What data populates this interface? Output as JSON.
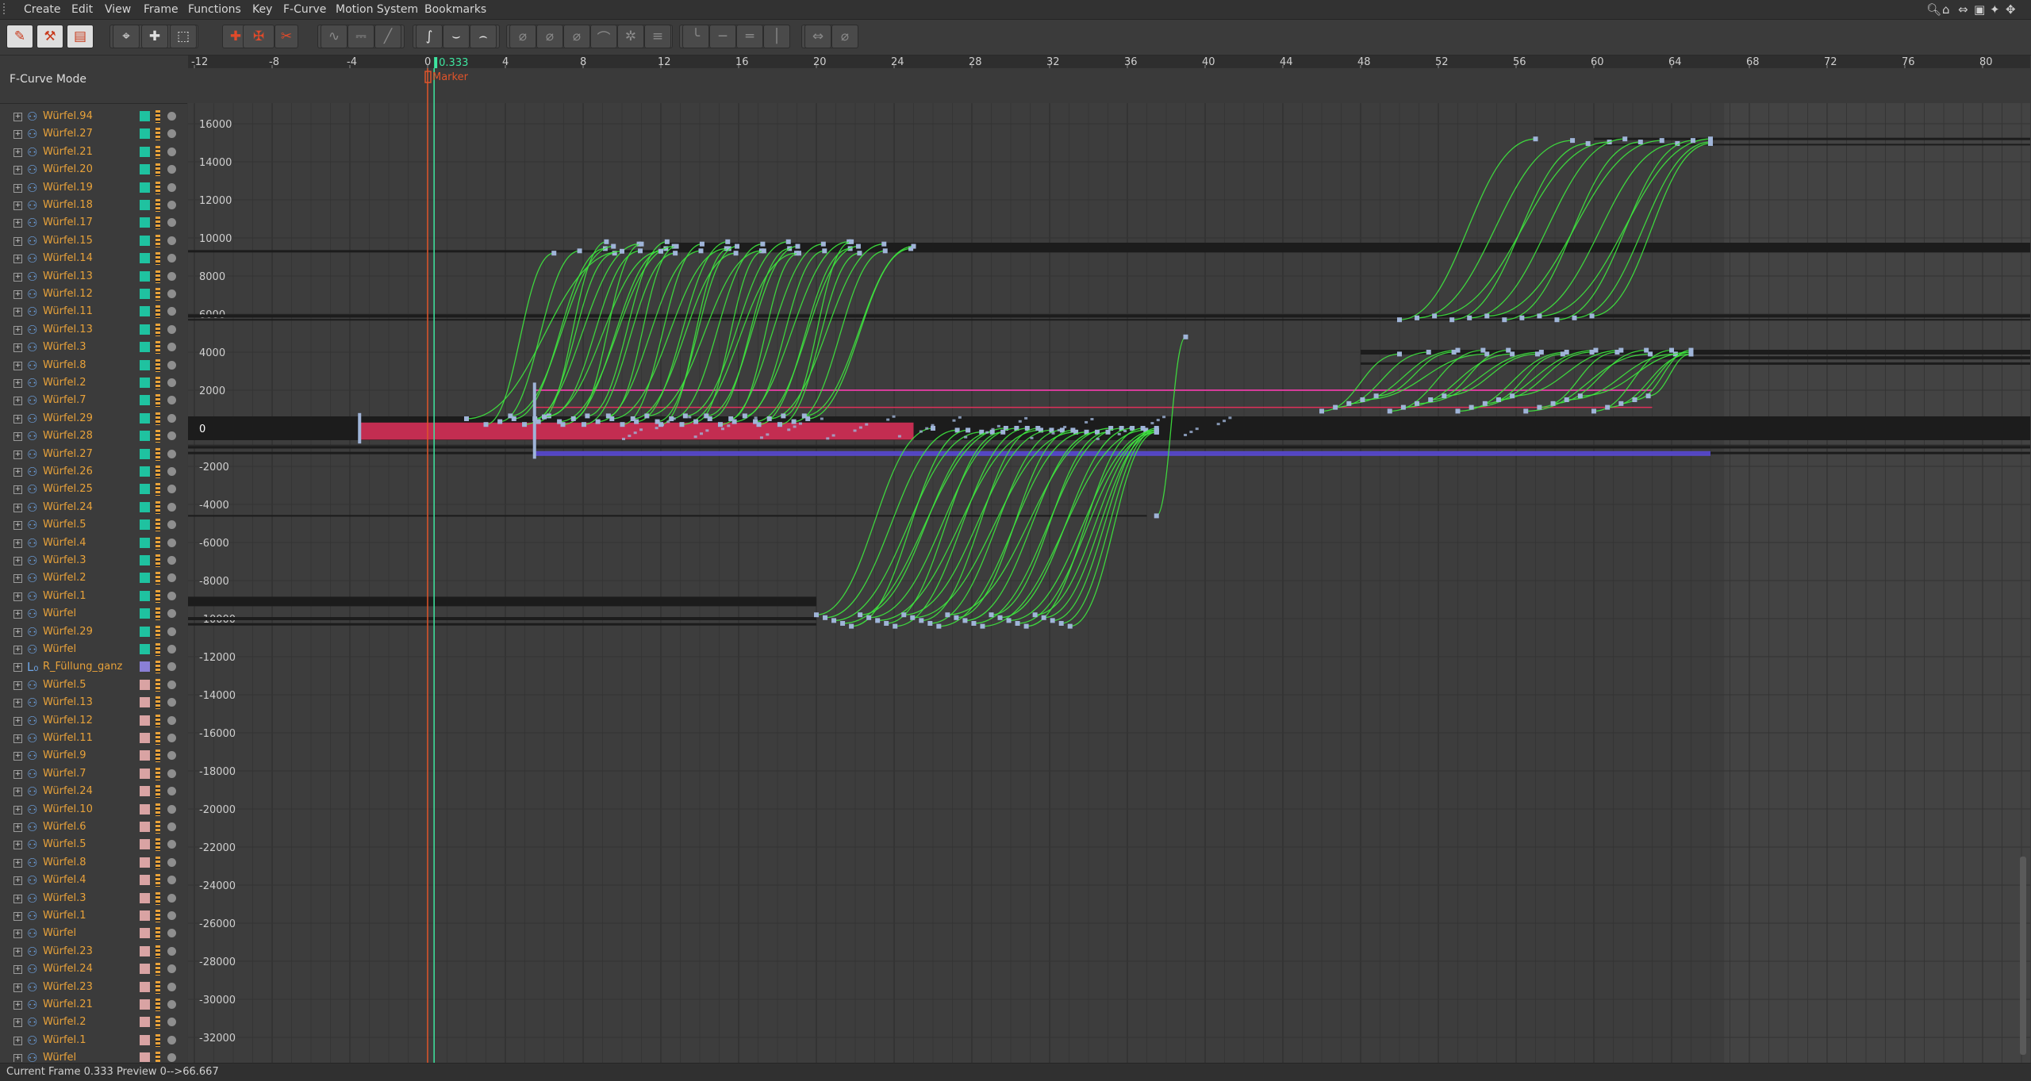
{
  "menu": [
    {
      "label": "Create",
      "key": "create"
    },
    {
      "label": "Edit",
      "key": "edit"
    },
    {
      "label": "View",
      "key": "view"
    },
    {
      "label": "Frame",
      "key": "frame"
    },
    {
      "label": "Functions",
      "key": "functions"
    },
    {
      "label": "Key",
      "key": "key"
    },
    {
      "label": "F-Curve",
      "key": "f-curve"
    },
    {
      "label": "Motion System",
      "key": "motion-system"
    },
    {
      "label": "Bookmarks",
      "key": "bookmarks"
    }
  ],
  "mode_label": "F-Curve Mode",
  "timeline": {
    "ticks": [
      "-12",
      "-8",
      "-4",
      "0",
      "4",
      "8",
      "12",
      "16",
      "20",
      "24",
      "28",
      "32",
      "36",
      "40",
      "44",
      "48",
      "52",
      "56",
      "60",
      "64",
      "68",
      "72",
      "76",
      "80"
    ],
    "current_frame": "0.333",
    "marker": "Marker"
  },
  "value_axis": [
    "16000",
    "14000",
    "12000",
    "10000",
    "8000",
    "6000",
    "4000",
    "2000",
    "0",
    "-2000",
    "-4000",
    "-6000",
    "-8000",
    "-10000",
    "-12000",
    "-14000",
    "-16000",
    "-18000",
    "-20000",
    "-22000",
    "-24000",
    "-26000",
    "-28000",
    "-30000",
    "-32000"
  ],
  "tree_items": [
    {
      "label": "Würfel.94",
      "color": "#1fc2a0"
    },
    {
      "label": "Würfel.27",
      "color": "#1fc2a0"
    },
    {
      "label": "Würfel.21",
      "color": "#1fc2a0"
    },
    {
      "label": "Würfel.20",
      "color": "#1fc2a0"
    },
    {
      "label": "Würfel.19",
      "color": "#1fc2a0"
    },
    {
      "label": "Würfel.18",
      "color": "#1fc2a0"
    },
    {
      "label": "Würfel.17",
      "color": "#1fc2a0"
    },
    {
      "label": "Würfel.15",
      "color": "#1fc2a0"
    },
    {
      "label": "Würfel.14",
      "color": "#1fc2a0"
    },
    {
      "label": "Würfel.13",
      "color": "#1fc2a0"
    },
    {
      "label": "Würfel.12",
      "color": "#1fc2a0"
    },
    {
      "label": "Würfel.11",
      "color": "#1fc2a0"
    },
    {
      "label": "Würfel.13",
      "color": "#1fc2a0"
    },
    {
      "label": "Würfel.3",
      "color": "#1fc2a0"
    },
    {
      "label": "Würfel.8",
      "color": "#1fc2a0"
    },
    {
      "label": "Würfel.2",
      "color": "#1fc2a0"
    },
    {
      "label": "Würfel.7",
      "color": "#1fc2a0"
    },
    {
      "label": "Würfel.29",
      "color": "#1fc2a0"
    },
    {
      "label": "Würfel.28",
      "color": "#1fc2a0"
    },
    {
      "label": "Würfel.27",
      "color": "#1fc2a0"
    },
    {
      "label": "Würfel.26",
      "color": "#1fc2a0"
    },
    {
      "label": "Würfel.25",
      "color": "#1fc2a0"
    },
    {
      "label": "Würfel.24",
      "color": "#1fc2a0"
    },
    {
      "label": "Würfel.5",
      "color": "#1fc2a0"
    },
    {
      "label": "Würfel.4",
      "color": "#1fc2a0"
    },
    {
      "label": "Würfel.3",
      "color": "#1fc2a0"
    },
    {
      "label": "Würfel.2",
      "color": "#1fc2a0"
    },
    {
      "label": "Würfel.1",
      "color": "#1fc2a0"
    },
    {
      "label": "Würfel",
      "color": "#1fc2a0"
    },
    {
      "label": "Würfel.29",
      "color": "#1fc2a0"
    },
    {
      "label": "Würfel",
      "color": "#1fc2a0"
    },
    {
      "label": "R_Füllung_ganz",
      "color": "#8a7fd6",
      "null": true
    },
    {
      "label": "Würfel.5",
      "color": "#d9a3a3"
    },
    {
      "label": "Würfel.13",
      "color": "#d9a3a3"
    },
    {
      "label": "Würfel.12",
      "color": "#d9a3a3"
    },
    {
      "label": "Würfel.11",
      "color": "#d9a3a3"
    },
    {
      "label": "Würfel.9",
      "color": "#d9a3a3"
    },
    {
      "label": "Würfel.7",
      "color": "#d9a3a3"
    },
    {
      "label": "Würfel.24",
      "color": "#d9a3a3"
    },
    {
      "label": "Würfel.10",
      "color": "#d9a3a3"
    },
    {
      "label": "Würfel.6",
      "color": "#d9a3a3"
    },
    {
      "label": "Würfel.5",
      "color": "#d9a3a3"
    },
    {
      "label": "Würfel.8",
      "color": "#d9a3a3"
    },
    {
      "label": "Würfel.4",
      "color": "#d9a3a3"
    },
    {
      "label": "Würfel.3",
      "color": "#d9a3a3"
    },
    {
      "label": "Würfel.1",
      "color": "#d9a3a3"
    },
    {
      "label": "Würfel",
      "color": "#d9a3a3"
    },
    {
      "label": "Würfel.23",
      "color": "#d9a3a3"
    },
    {
      "label": "Würfel.24",
      "color": "#d9a3a3"
    },
    {
      "label": "Würfel.23",
      "color": "#d9a3a3"
    },
    {
      "label": "Würfel.21",
      "color": "#d9a3a3"
    },
    {
      "label": "Würfel.2",
      "color": "#d9a3a3"
    },
    {
      "label": "Würfel.1",
      "color": "#d9a3a3"
    },
    {
      "label": "Würfel",
      "color": "#d9a3a3"
    }
  ],
  "status": "Current Frame  0.333  Preview  0-->66.667",
  "colors": {
    "curve_green": "#3ee63e",
    "position_red": "#e0305a",
    "pink": "#d63c9a",
    "blue": "#5a4ad6",
    "key": "#9fb4d8",
    "frame_line": "#e0542a",
    "current_line": "#3ee6a0"
  }
}
